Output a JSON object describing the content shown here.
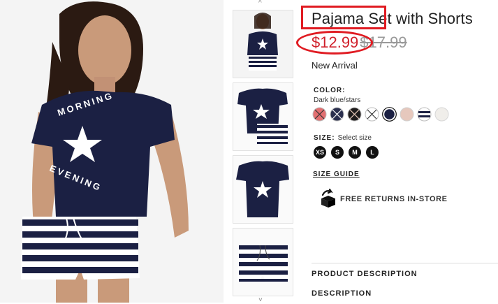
{
  "product": {
    "title": "Pajama Set with Shorts",
    "price": "$12.99",
    "old_price": "$17.99",
    "tag": "New Arrival"
  },
  "color": {
    "label": "COLOR:",
    "value": "Dark blue/stars",
    "swatches": [
      {
        "name": "red-crossed",
        "color": "#e36f71"
      },
      {
        "name": "dark-blue-crossed",
        "color": "#2a2f4e"
      },
      {
        "name": "black-crossed",
        "color": "#1e1b1b"
      },
      {
        "name": "white-crossed",
        "color": "#ffffff"
      },
      {
        "name": "dark-blue-stars",
        "color": "#1b2043"
      },
      {
        "name": "powder-pink",
        "color": "#e6c8bd"
      },
      {
        "name": "blue-striped",
        "color": "#1b2043"
      },
      {
        "name": "off-white",
        "color": "#f0eeea"
      }
    ]
  },
  "size": {
    "label": "SIZE:",
    "select_text": "Select size",
    "options": [
      "XS",
      "S",
      "M",
      "L"
    ]
  },
  "links": {
    "size_guide": "SIZE GUIDE",
    "returns": "FREE RETURNS IN-STORE",
    "product_description": "PRODUCT DESCRIPTION",
    "description": "DESCRIPTION"
  },
  "shirt_print": {
    "top": "MORNING",
    "bottom": "EVENING"
  },
  "nav": {
    "up": "^",
    "down": "˅"
  },
  "colors": {
    "navy": "#1b2043",
    "price_red": "#d0202b",
    "annotation_red": "#e01b22"
  }
}
